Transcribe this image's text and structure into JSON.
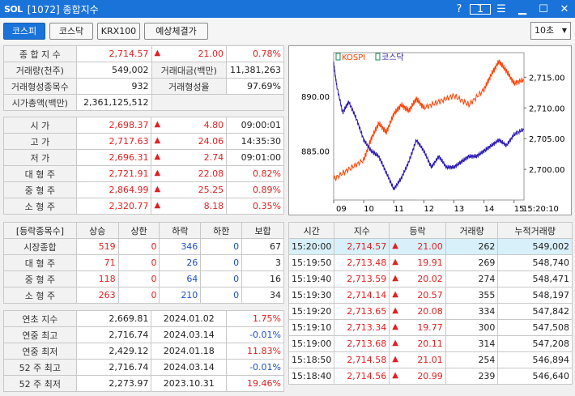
{
  "window": {
    "logo": "SOL",
    "title": "[1072] 종합지수",
    "help": "?",
    "box": "1"
  },
  "toolbar": {
    "tabs": [
      "코스피",
      "코스닥",
      "KRX100",
      "예상체결가"
    ],
    "interval": "10초"
  },
  "summary": {
    "rows": [
      {
        "label": "종 합 지 수",
        "value": "2,714.57",
        "change": "21.00",
        "rate": "0.78%"
      },
      {
        "label": "거래량(천주)",
        "value": "549,002",
        "label2": "거래대금(백만)",
        "value2": "11,381,263"
      },
      {
        "label": "거래형성종목수",
        "value": "932",
        "label2": "거래형성율",
        "value2": "97.69%"
      },
      {
        "label": "시가총액(백만)",
        "value": "2,361,125,512"
      }
    ]
  },
  "prices": [
    {
      "label": "시     가",
      "value": "2,698.37",
      "change": "4.80",
      "extra": "09:00:01"
    },
    {
      "label": "고     가",
      "value": "2,717.63",
      "change": "24.06",
      "extra": "14:35:30"
    },
    {
      "label": "저     가",
      "value": "2,696.31",
      "change": "2.74",
      "extra": "09:01:00"
    },
    {
      "label": "대 형 주",
      "value": "2,721.91",
      "change": "22.08",
      "extra": "0.82%"
    },
    {
      "label": "중 형 주",
      "value": "2,864.99",
      "change": "25.25",
      "extra": "0.89%"
    },
    {
      "label": "소 형 주",
      "value": "2,320.77",
      "change": "8.18",
      "extra": "0.35%"
    }
  ],
  "breadth": {
    "headers": [
      "[등락종목수]",
      "상승",
      "상한",
      "하락",
      "하한",
      "보합"
    ],
    "rows": [
      {
        "label": "시장종합",
        "values": [
          "519",
          "0",
          "346",
          "0",
          "67"
        ]
      },
      {
        "label": "대 형 주",
        "values": [
          "71",
          "0",
          "26",
          "0",
          "3"
        ]
      },
      {
        "label": "중 형 주",
        "values": [
          "118",
          "0",
          "64",
          "0",
          "16"
        ]
      },
      {
        "label": "소 형 주",
        "values": [
          "263",
          "0",
          "210",
          "0",
          "34"
        ]
      }
    ]
  },
  "yearly": [
    {
      "label": "연초  지수",
      "value": "2,669.81",
      "date": "2024.01.02",
      "rate": "1.75%"
    },
    {
      "label": "연중  최고",
      "value": "2,716.74",
      "date": "2024.03.14",
      "rate": "-0.01%"
    },
    {
      "label": "연중  최저",
      "value": "2,429.12",
      "date": "2024.01.18",
      "rate": "11.83%"
    },
    {
      "label": "52 주 최고",
      "value": "2,716.74",
      "date": "2024.03.14",
      "rate": "-0.01%"
    },
    {
      "label": "52 주 최저",
      "value": "2,273.97",
      "date": "2023.10.31",
      "rate": "19.46%"
    }
  ],
  "ticks": {
    "headers": [
      "시간",
      "지수",
      "등락",
      "거래량",
      "누적거래량"
    ],
    "rows": [
      {
        "time": "15:20:00",
        "index": "2,714.57",
        "change": "21.00",
        "volume": "262",
        "cum": "549,002"
      },
      {
        "time": "15:19:50",
        "index": "2,713.48",
        "change": "19.91",
        "volume": "269",
        "cum": "548,740"
      },
      {
        "time": "15:19:40",
        "index": "2,713.59",
        "change": "20.02",
        "volume": "274",
        "cum": "548,471"
      },
      {
        "time": "15:19:30",
        "index": "2,714.14",
        "change": "20.57",
        "volume": "355",
        "cum": "548,197"
      },
      {
        "time": "15:19:20",
        "index": "2,713.65",
        "change": "20.08",
        "volume": "334",
        "cum": "547,842"
      },
      {
        "time": "15:19:10",
        "index": "2,713.34",
        "change": "19.77",
        "volume": "300",
        "cum": "547,508"
      },
      {
        "time": "15:19:00",
        "index": "2,713.68",
        "change": "20.11",
        "volume": "314",
        "cum": "547,208"
      },
      {
        "time": "15:18:50",
        "index": "2,714.58",
        "change": "21.01",
        "volume": "254",
        "cum": "546,894"
      },
      {
        "time": "15:18:40",
        "index": "2,714.56",
        "change": "20.99",
        "volume": "239",
        "cum": "546,640"
      }
    ]
  },
  "chart_data": {
    "type": "line",
    "legend": [
      "KOSPI",
      "코스닥"
    ],
    "x_ticks": [
      "09",
      "10",
      "11",
      "12",
      "13",
      "14",
      "15",
      "15:20:10"
    ],
    "left_axis": {
      "ticks": [
        "890.00",
        "885.00"
      ],
      "range": [
        880.5,
        894
      ]
    },
    "right_axis": {
      "ticks": [
        "2,715.00",
        "2,710.00",
        "2,705.00",
        "2,700.00"
      ],
      "range": [
        2695,
        2719
      ]
    },
    "series": [
      {
        "name": "KOSPI",
        "color": "#ff4000",
        "axis": "right",
        "x": [
          9.0,
          9.5,
          10.0,
          10.25,
          10.5,
          10.75,
          11.0,
          11.25,
          11.5,
          11.75,
          12.0,
          12.5,
          13.0,
          13.5,
          14.0,
          14.25,
          14.5,
          14.75,
          15.0,
          15.33
        ],
        "y": [
          2698.4,
          2700.0,
          2701.5,
          2705.0,
          2707.5,
          2706.0,
          2709.0,
          2710.5,
          2709.5,
          2711.5,
          2710.0,
          2711.0,
          2712.0,
          2710.5,
          2713.0,
          2715.5,
          2717.6,
          2716.0,
          2714.0,
          2714.6
        ]
      },
      {
        "name": "코스닥",
        "color": "#2a18b0",
        "axis": "left",
        "x": [
          9.0,
          9.1,
          9.3,
          9.5,
          9.75,
          10.0,
          10.25,
          10.5,
          10.75,
          11.0,
          11.25,
          11.5,
          11.75,
          12.0,
          12.25,
          12.5,
          12.75,
          13.0,
          13.25,
          13.5,
          13.75,
          14.0,
          14.25,
          14.5,
          14.75,
          15.0,
          15.33
        ],
        "y": [
          893.0,
          891.0,
          888.5,
          889.5,
          888.0,
          886.0,
          885.0,
          884.5,
          883.0,
          881.5,
          882.5,
          884.0,
          886.0,
          885.0,
          883.5,
          884.5,
          883.5,
          883.5,
          884.0,
          884.5,
          884.5,
          885.0,
          885.5,
          886.0,
          885.5,
          886.5,
          887.0
        ]
      }
    ]
  }
}
